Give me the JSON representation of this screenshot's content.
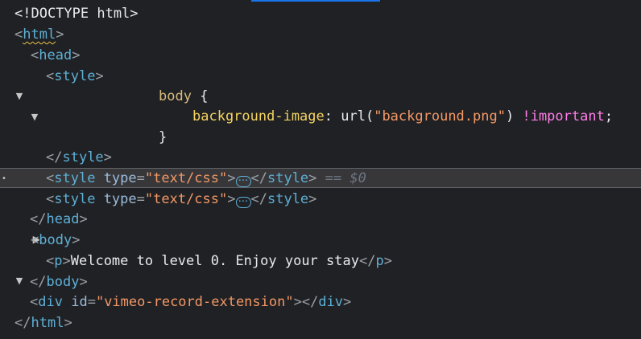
{
  "panel": "elements-tree",
  "accent_color": "#1a73e8",
  "selected_line_marker": "== $0",
  "lines": {
    "doctype": "<!DOCTYPE html>",
    "html_open": {
      "tag": "html"
    },
    "head_open": {
      "tag": "head"
    },
    "style_open": {
      "tag": "style"
    },
    "css_selector": "body",
    "css_brace_open": "{",
    "css_property": "background-image",
    "css_func": "url(",
    "css_url": "\"background.png\"",
    "css_func_close": ")",
    "css_important": "!important",
    "css_semicolon": ";",
    "css_brace_close": "}",
    "style_close": {
      "tag": "style"
    },
    "style_css_1": {
      "tag": "style",
      "attr_name": "type",
      "attr_value": "\"text/css\""
    },
    "style_css_2": {
      "tag": "style",
      "attr_name": "type",
      "attr_value": "\"text/css\""
    },
    "head_close": {
      "tag": "head"
    },
    "body_open": {
      "tag": "body"
    },
    "p_elem": {
      "tag": "p",
      "text": "Welcome to level 0. Enjoy your stay"
    },
    "body_close": {
      "tag": "body"
    },
    "div_elem": {
      "tag": "div",
      "attr_name": "id",
      "attr_value": "\"vimeo-record-extension\""
    },
    "html_close": {
      "tag": "html"
    }
  },
  "icons": {
    "expanded": "triangle-down-icon",
    "collapsed": "triangle-right-icon",
    "ellipsis": "ellipsis-icon",
    "selected": "bullet-icon"
  }
}
